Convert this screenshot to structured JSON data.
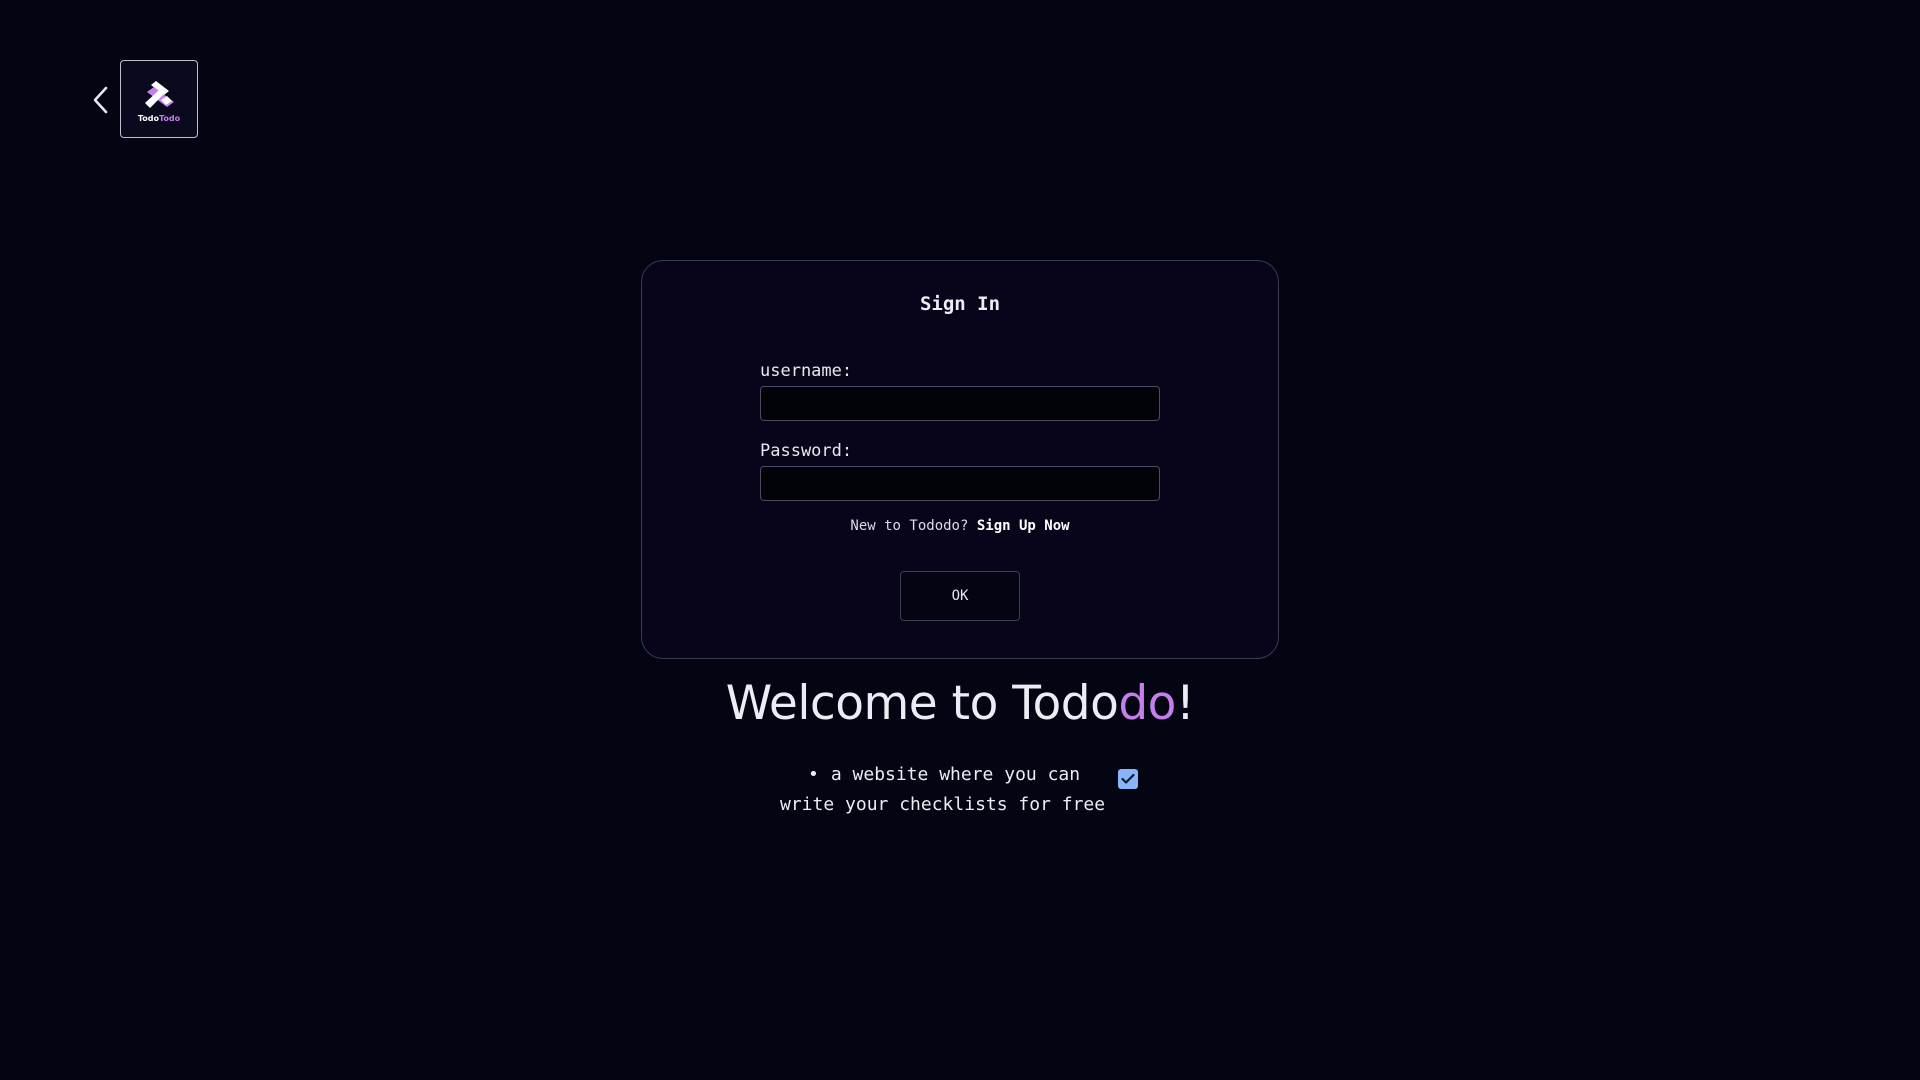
{
  "nav": {
    "back_icon": "chevron-left-icon",
    "logo": {
      "text_part1": "Todo",
      "text_part2": "Todo"
    }
  },
  "signin": {
    "title": "Sign In",
    "username_label": "username:",
    "username_value": "",
    "password_label": "Password:",
    "password_value": "",
    "signup_prompt": "New to Tododo?",
    "signup_link": "Sign Up Now",
    "ok_label": "OK"
  },
  "welcome": {
    "prefix": "Welcome to Todo",
    "accent": "do",
    "suffix": "!"
  },
  "tagline": {
    "bullet": "•",
    "line1": "a website where you can",
    "line2": "write your checklists for free",
    "checkbox_checked": true
  },
  "colors": {
    "background": "#030512",
    "card_background": "#08051a",
    "accent_purple": "#c77dea",
    "checkbox_blue": "#8ab4f8"
  }
}
